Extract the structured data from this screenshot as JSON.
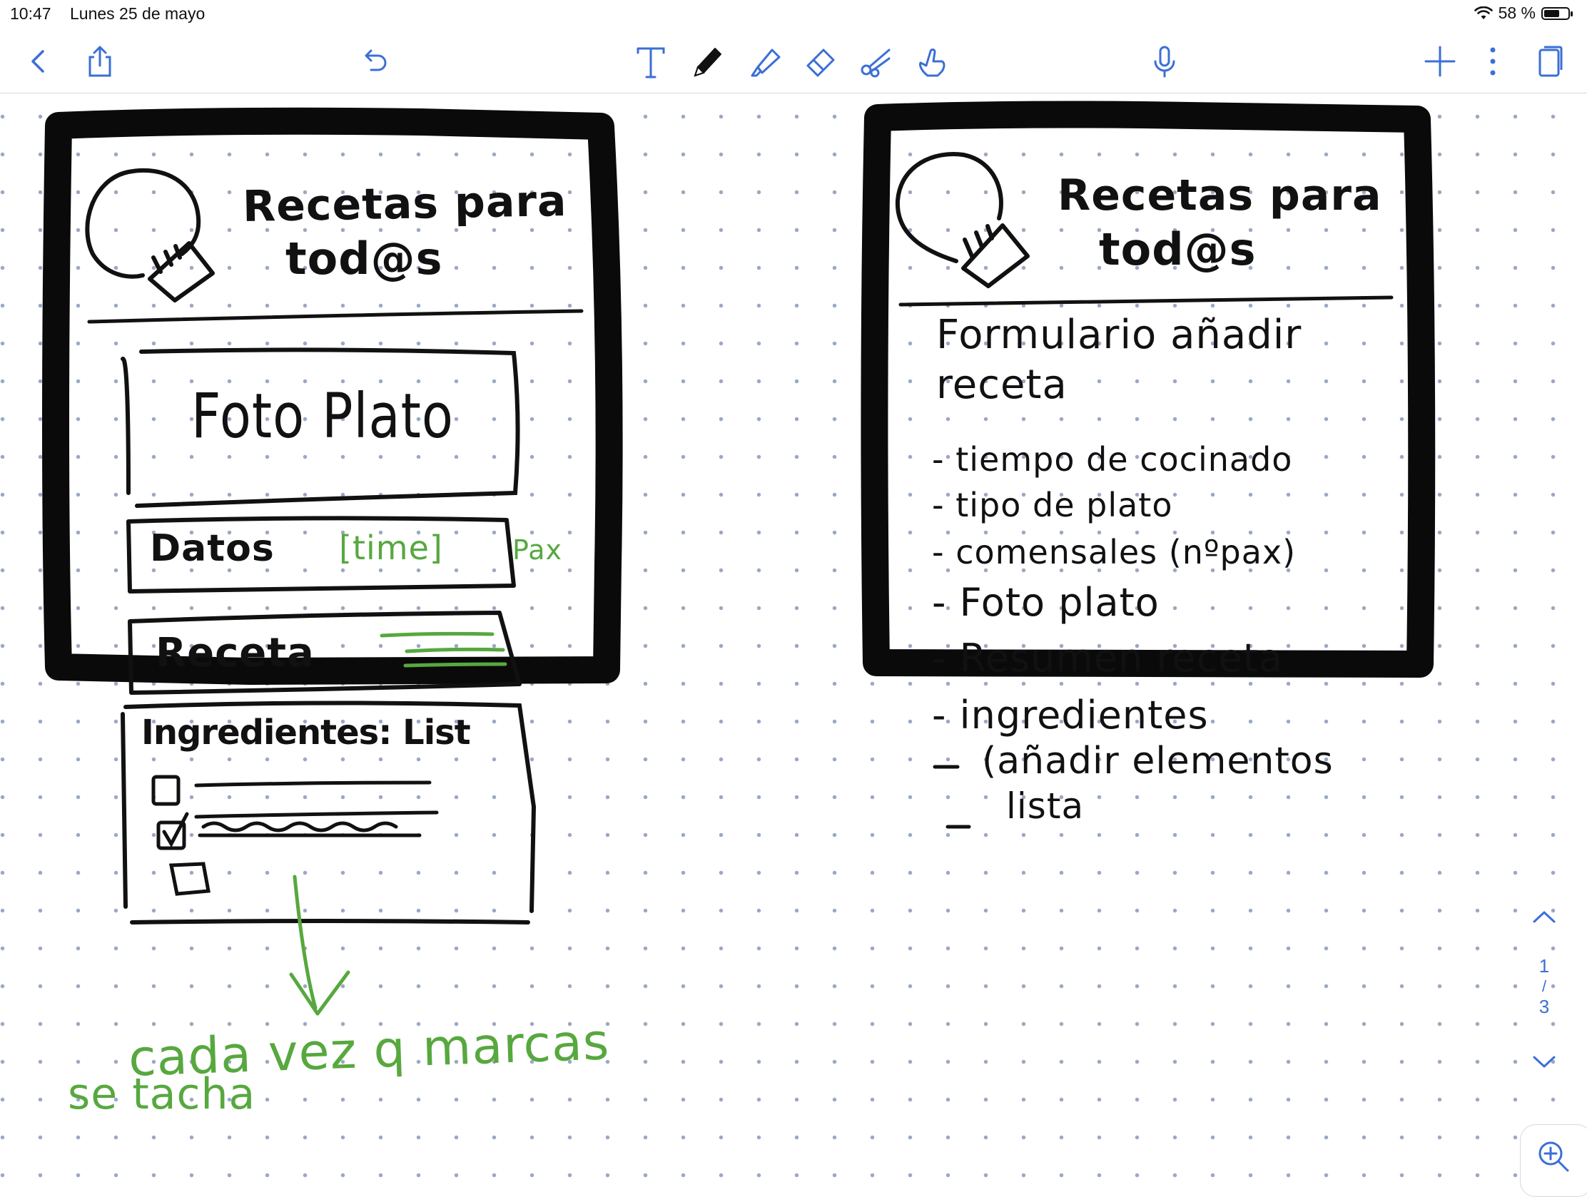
{
  "status_bar": {
    "time": "10:47",
    "date": "Lunes 25 de mayo",
    "battery": "58 %"
  },
  "toolbar": {
    "icons": [
      "back-icon",
      "share-icon",
      "undo-icon",
      "text-tool-icon",
      "pen-icon",
      "highlighter-icon",
      "eraser-icon",
      "lasso-scissors-icon",
      "pointer-hand-icon",
      "microphone-icon",
      "add-page-icon",
      "more-icon",
      "page-view-icon"
    ],
    "accent": "#3b6fd6"
  },
  "sketch_left": {
    "app_title_line1": "Recetas para",
    "app_title_line2": "tod@s",
    "photo_box": "Foto Plato",
    "data_box_label": "Datos",
    "data_box_time": "[time]",
    "data_box_pax": "Pax",
    "recipe_box": "Receta",
    "ingredients_box": "Ingredientes: List",
    "annotation_line1": "cada vez q marcas",
    "annotation_line2": "se tacha"
  },
  "sketch_right": {
    "app_title_line1": "Recetas para",
    "app_title_line2": "tod@s",
    "form_title_line1": "Formulario añadir",
    "form_title_line2": "receta",
    "items": [
      "- tiempo de cocinado",
      "- tipo de plato",
      "- comensales (nºpax)",
      "- Foto plato",
      "- Resumen receta",
      "- ingredientes",
      "(añadir elementos",
      "lista"
    ]
  },
  "page_nav": {
    "current": "1",
    "separator": "/",
    "total": "3"
  },
  "colors": {
    "ink": "#111111",
    "green_ink": "#57a83f",
    "grid_dot": "#9aa8c4"
  }
}
